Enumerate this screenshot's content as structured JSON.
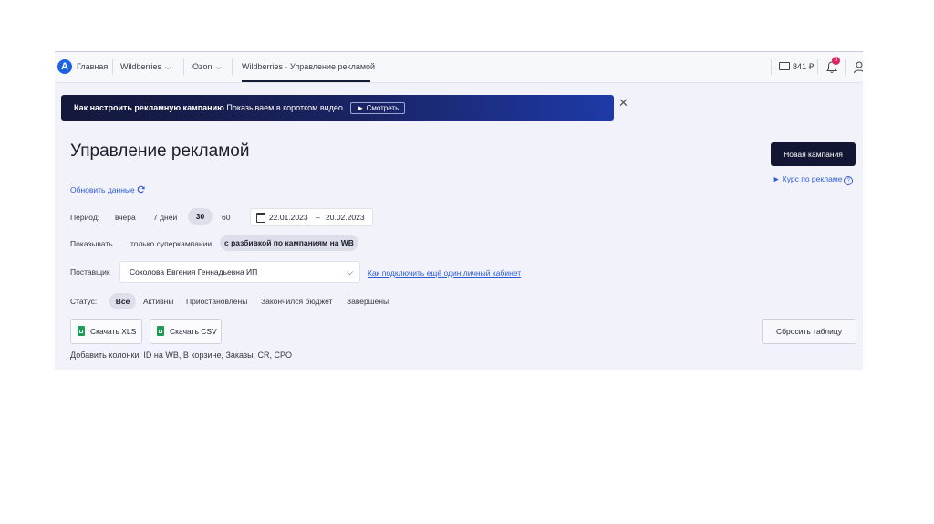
{
  "nav": {
    "logo_letter": "A",
    "home": "Главная",
    "wildberries": "Wildberries",
    "ozon": "Ozon",
    "active_tab": "Wildberries · Управление рекламой",
    "balance": "841 ₽",
    "notifications_count": "0"
  },
  "banner": {
    "title": "Как настроить рекламную кампанию",
    "subtitle": "Показываем в коротком видео",
    "watch_label": "► Смотреть"
  },
  "page": {
    "title": "Управление рекламой",
    "new_campaign": "Новая кампания",
    "course_link": "► Курс по рекламе",
    "refresh": "Обновить данные"
  },
  "period": {
    "label": "Период:",
    "options": [
      "вчера",
      "7 дней",
      "30",
      "60"
    ],
    "selected": "30",
    "date_from": "22.01.2023",
    "date_to": "20.02.2023"
  },
  "show": {
    "label": "Показывать",
    "options": [
      "только суперкампании",
      "с разбивкой по кампаниям на WB"
    ],
    "selected": "с разбивкой по кампаниям на WB"
  },
  "supplier": {
    "label": "Поставщик",
    "value": "Соколова Евгения Геннадьевна ИП",
    "connect_link": "Как подключить ещё один личный кабинет"
  },
  "status": {
    "label": "Статус:",
    "options": [
      "Все",
      "Активны",
      "Приостановлены",
      "Закончился бюджет",
      "Завершены"
    ],
    "selected": "Все"
  },
  "actions": {
    "download_xls": "Скачать XLS",
    "download_csv": "Скачать CSV",
    "reset_table": "Сбросить таблицу"
  },
  "columns": {
    "text": "Добавить колонки: ID на WB, В корзине, Заказы, CR, CPO"
  },
  "colors": {
    "brand": "#1c63e0",
    "primary_button": "#121633",
    "link": "#2f5bd8",
    "badge": "#e0245e",
    "excel_green": "#1f9d55"
  }
}
